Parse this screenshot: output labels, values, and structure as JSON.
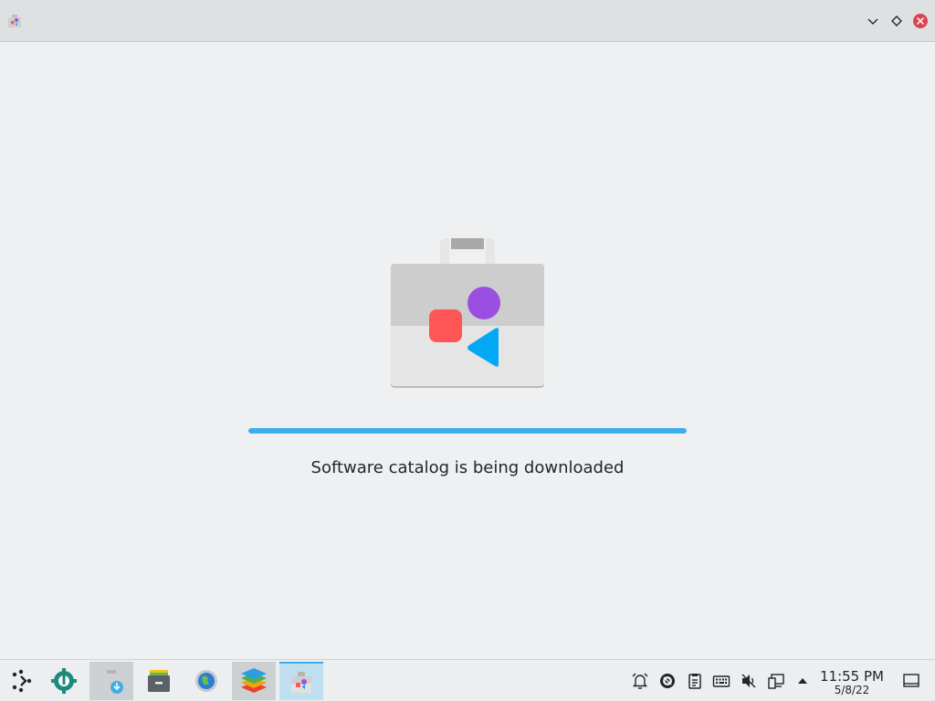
{
  "window": {
    "app_icon": "discover-icon",
    "controls": [
      "chevron-down-icon",
      "diamond-icon",
      "close-icon"
    ]
  },
  "main": {
    "icon": "discover-store-icon",
    "progress_fraction": 1.0,
    "status_text": "Software catalog is being downloaded"
  },
  "taskbar": {
    "launcher_icon": "app-launcher-icon",
    "apps": [
      {
        "name": "system-settings-icon",
        "state": "normal"
      },
      {
        "name": "discover-download-icon",
        "state": "active"
      },
      {
        "name": "file-archive-icon",
        "state": "normal"
      },
      {
        "name": "web-browser-icon",
        "state": "normal"
      },
      {
        "name": "layers-app-icon",
        "state": "active"
      },
      {
        "name": "discover-icon",
        "state": "focused"
      }
    ],
    "tray": [
      "alarm-icon",
      "vault-icon",
      "clipboard-icon",
      "keyboard-icon",
      "volume-muted-icon",
      "network-icon",
      "expand-tray-icon"
    ],
    "clock": {
      "time": "11:55 PM",
      "date": "5/8/22"
    },
    "show_desktop_icon": "show-desktop-icon"
  },
  "colors": {
    "accent": "#3daee9",
    "background": "#eff0f1",
    "icon_purple": "#9b4fe0",
    "icon_red": "#ff5555",
    "icon_blue": "#03a9f4"
  }
}
